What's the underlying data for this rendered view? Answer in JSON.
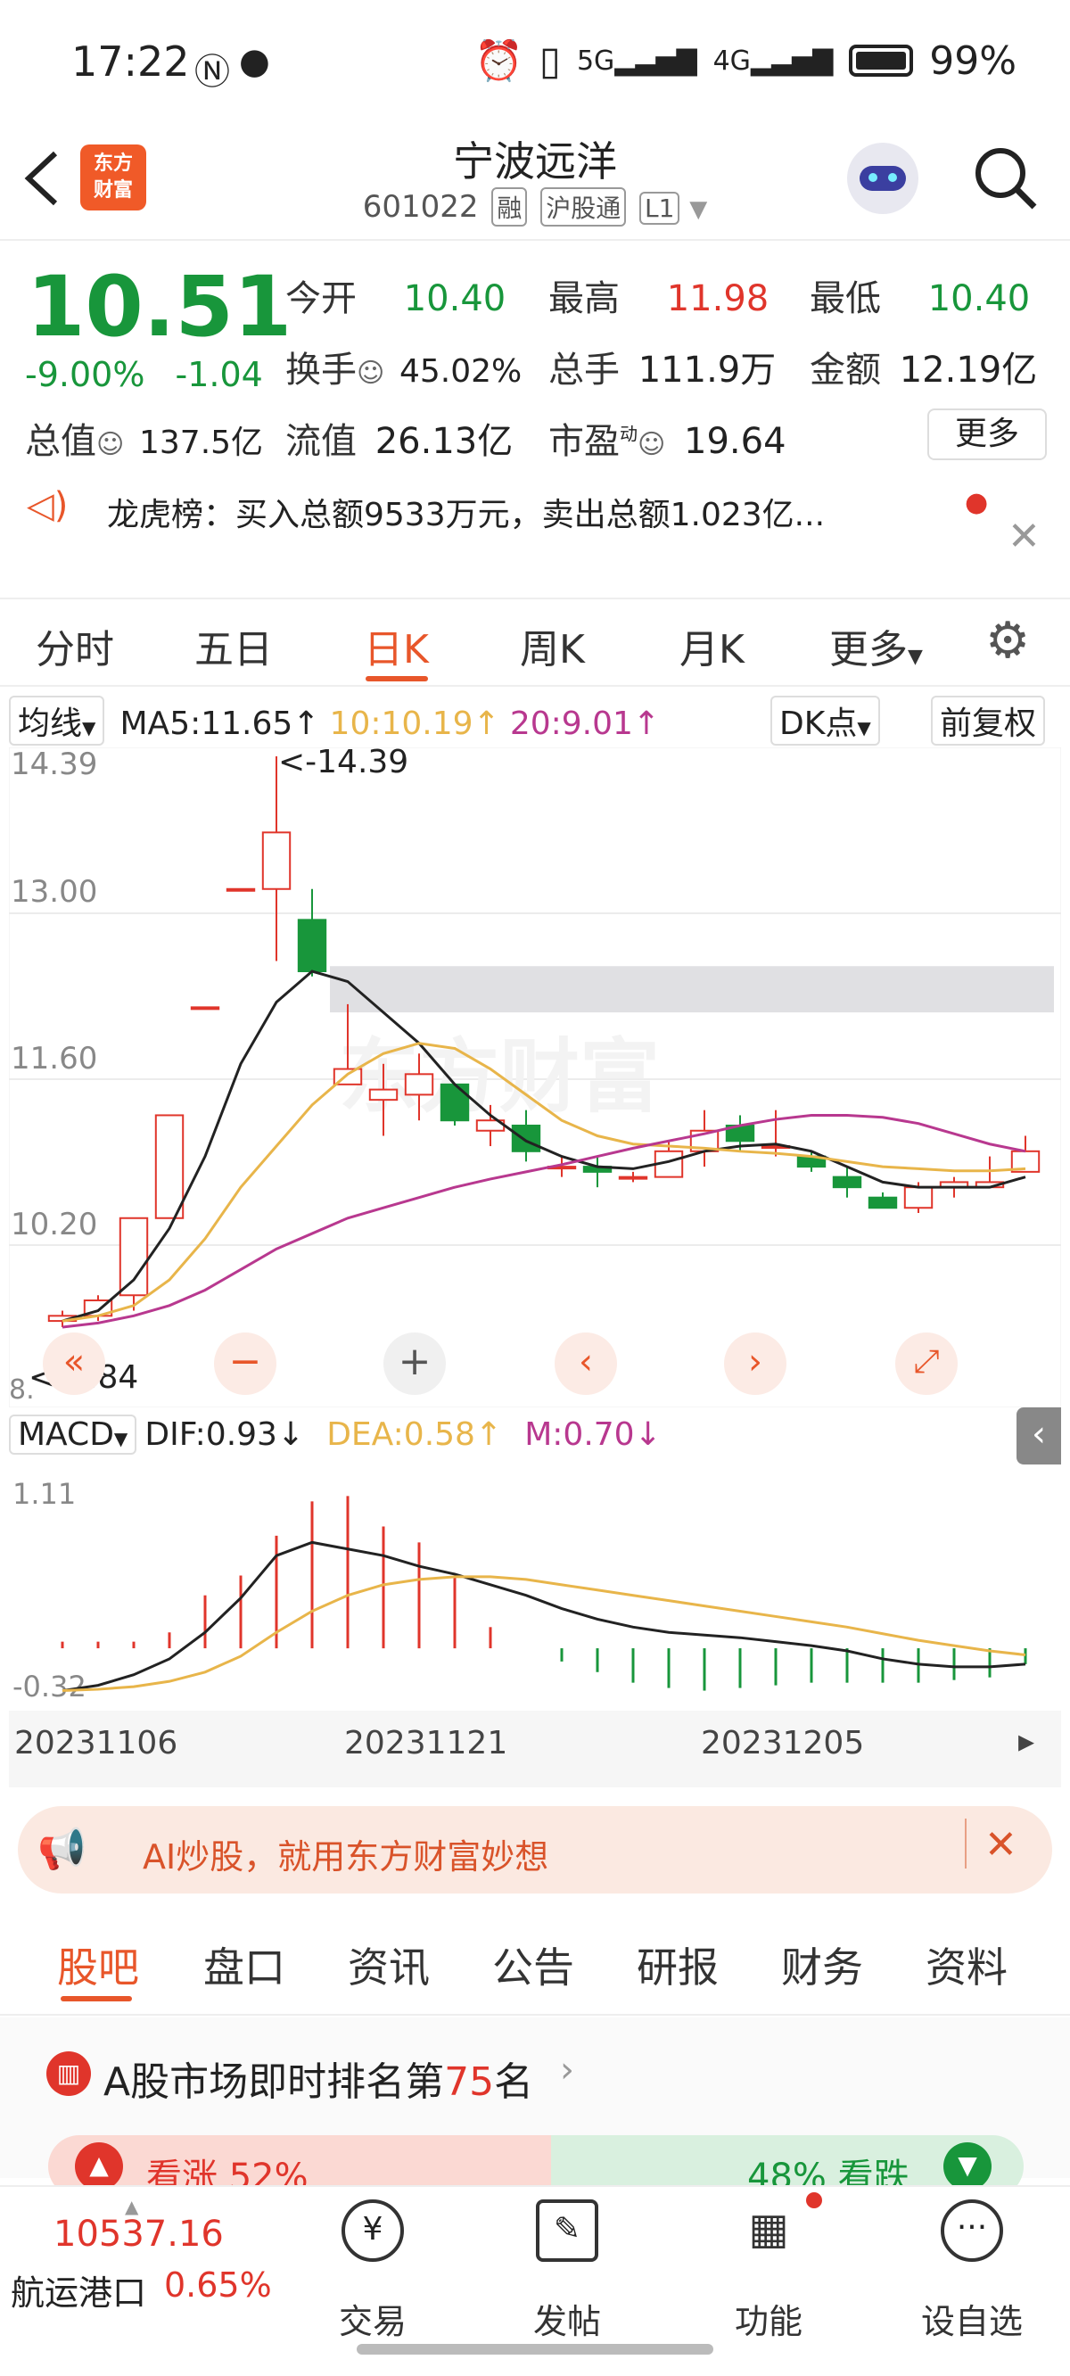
{
  "status_bar": {
    "time": "17:22",
    "network_icons": [
      "nfc-icon",
      "wechat-icon",
      "alarm-icon",
      "vibrate-icon",
      "5g-signal-icon",
      "4g-signal-icon"
    ],
    "battery": "99%"
  },
  "header": {
    "logo_text_line1": "东方",
    "logo_text_line2": "财富",
    "stock_name": "宁波远洋",
    "stock_code": "601022",
    "tag_margin": "融",
    "tag_connect": "沪股通",
    "tag_level": "L1"
  },
  "quote": {
    "price": "10.51",
    "change_pct": "-9.00%",
    "change_amt": "-1.04",
    "open_label": "今开",
    "open": "10.40",
    "high_label": "最高",
    "high": "11.98",
    "low_label": "最低",
    "low": "10.40",
    "turnover_label": "换手",
    "turnover": "45.02%",
    "volume_label": "总手",
    "volume": "111.9万",
    "amount_label": "金额",
    "amount": "12.19亿",
    "mktcap_label": "总值",
    "mktcap": "137.5亿",
    "float_label": "流值",
    "float_cap": "26.13亿",
    "pe_label": "市盈",
    "pe_sup": "动",
    "pe": "19.64",
    "more_label": "更多"
  },
  "notice": {
    "text": "龙虎榜：买入总额9533万元，卖出总额1.023亿..."
  },
  "chart_tabs": {
    "items": [
      "分时",
      "五日",
      "日K",
      "周K",
      "月K",
      "更多"
    ],
    "active_index": 2
  },
  "kline": {
    "indicator_label": "均线",
    "ma5": "MA5:11.65↑",
    "ma10": "10:10.19↑",
    "ma20": "20:9.01↑",
    "dk_label": "DK点",
    "adjust_label": "前复权",
    "y_labels": [
      "14.39",
      "13.00",
      "11.60",
      "10.20"
    ],
    "max_marker": "<-14.39",
    "min_marker": "<-8.84",
    "min_label_partial": "8.",
    "watermark": "东方财富",
    "colors": {
      "up": "#e0352b",
      "down": "#18963b",
      "ma5": "#222222",
      "ma10": "#e8b54a",
      "ma20": "#b8388f"
    }
  },
  "macd": {
    "indicator_label": "MACD",
    "dif": "DIF:0.93↓",
    "dea": "DEA:0.58↑",
    "m": "M:0.70↓",
    "y_top": "1.11",
    "y_bottom": "-0.32",
    "dates": [
      "20231106",
      "20231121",
      "20231205"
    ]
  },
  "chart_data": {
    "type": "candlestick",
    "ylim": [
      8.84,
      14.39
    ],
    "candles": [
      {
        "o": 8.9,
        "c": 8.95,
        "h": 9.0,
        "l": 8.84
      },
      {
        "o": 8.95,
        "c": 9.1,
        "h": 9.15,
        "l": 8.9
      },
      {
        "o": 9.15,
        "c": 9.9,
        "h": 9.9,
        "l": 9.0
      },
      {
        "o": 9.9,
        "c": 10.9,
        "h": 10.9,
        "l": 9.9
      },
      {
        "o": 11.95,
        "c": 11.95,
        "h": 11.95,
        "l": 11.95
      },
      {
        "o": 13.1,
        "c": 13.1,
        "h": 13.1,
        "l": 13.1
      },
      {
        "o": 13.1,
        "c": 13.65,
        "h": 14.39,
        "l": 12.4
      },
      {
        "o": 12.8,
        "c": 12.3,
        "h": 13.1,
        "l": 12.25
      },
      {
        "o": 11.2,
        "c": 11.35,
        "h": 11.98,
        "l": 11.2
      },
      {
        "o": 11.05,
        "c": 11.15,
        "h": 11.4,
        "l": 10.7
      },
      {
        "o": 11.1,
        "c": 11.3,
        "h": 11.5,
        "l": 10.85
      },
      {
        "o": 11.2,
        "c": 10.85,
        "h": 11.2,
        "l": 10.8
      },
      {
        "o": 10.75,
        "c": 10.85,
        "h": 11.0,
        "l": 10.6
      },
      {
        "o": 10.8,
        "c": 10.55,
        "h": 10.95,
        "l": 10.45
      },
      {
        "o": 10.4,
        "c": 10.4,
        "h": 10.5,
        "l": 10.3
      },
      {
        "o": 10.4,
        "c": 10.35,
        "h": 10.5,
        "l": 10.2
      },
      {
        "o": 10.3,
        "c": 10.3,
        "h": 10.35,
        "l": 10.25
      },
      {
        "o": 10.3,
        "c": 10.55,
        "h": 10.65,
        "l": 10.3
      },
      {
        "o": 10.55,
        "c": 10.75,
        "h": 10.95,
        "l": 10.4
      },
      {
        "o": 10.8,
        "c": 10.65,
        "h": 10.9,
        "l": 10.55
      },
      {
        "o": 10.6,
        "c": 10.6,
        "h": 10.95,
        "l": 10.5
      },
      {
        "o": 10.5,
        "c": 10.4,
        "h": 10.55,
        "l": 10.35
      },
      {
        "o": 10.3,
        "c": 10.2,
        "h": 10.4,
        "l": 10.1
      },
      {
        "o": 10.1,
        "c": 10.0,
        "h": 10.15,
        "l": 10.0
      },
      {
        "o": 10.0,
        "c": 10.2,
        "h": 10.25,
        "l": 9.95
      },
      {
        "o": 10.2,
        "c": 10.25,
        "h": 10.3,
        "l": 10.1
      },
      {
        "o": 10.2,
        "c": 10.25,
        "h": 10.5,
        "l": 10.2
      },
      {
        "o": 10.35,
        "c": 10.55,
        "h": 10.7,
        "l": 10.35
      }
    ],
    "ma5": [
      8.9,
      9.0,
      9.3,
      9.8,
      10.5,
      11.4,
      12.0,
      12.3,
      12.2,
      11.9,
      11.6,
      11.2,
      10.9,
      10.65,
      10.5,
      10.4,
      10.38,
      10.45,
      10.55,
      10.6,
      10.62,
      10.55,
      10.4,
      10.25,
      10.2,
      10.2,
      10.2,
      10.3
    ],
    "ma10": [
      8.9,
      8.95,
      9.05,
      9.3,
      9.7,
      10.2,
      10.6,
      11.0,
      11.3,
      11.5,
      11.6,
      11.55,
      11.35,
      11.1,
      10.85,
      10.7,
      10.62,
      10.6,
      10.58,
      10.55,
      10.53,
      10.5,
      10.45,
      10.4,
      10.38,
      10.36,
      10.36,
      10.38
    ],
    "ma20": [
      8.84,
      8.88,
      8.95,
      9.05,
      9.2,
      9.4,
      9.6,
      9.75,
      9.9,
      10.0,
      10.1,
      10.2,
      10.28,
      10.35,
      10.42,
      10.5,
      10.58,
      10.65,
      10.72,
      10.8,
      10.86,
      10.9,
      10.9,
      10.88,
      10.82,
      10.72,
      10.62,
      10.55
    ],
    "resistance_band": [
      11.9,
      12.35
    ],
    "macd_hist": [
      0.05,
      0.05,
      0.05,
      0.12,
      0.4,
      0.55,
      0.85,
      1.11,
      1.15,
      0.92,
      0.8,
      0.55,
      0.16,
      0.0,
      -0.1,
      -0.18,
      -0.26,
      -0.3,
      -0.32,
      -0.3,
      -0.28,
      -0.26,
      -0.26,
      -0.26,
      -0.26,
      -0.24,
      -0.22,
      -0.12
    ],
    "macd_dif": [
      -0.32,
      -0.28,
      -0.2,
      -0.08,
      0.12,
      0.38,
      0.7,
      0.8,
      0.75,
      0.7,
      0.62,
      0.56,
      0.48,
      0.4,
      0.3,
      0.22,
      0.16,
      0.12,
      0.1,
      0.08,
      0.05,
      0.02,
      -0.02,
      -0.08,
      -0.12,
      -0.14,
      -0.14,
      -0.12
    ],
    "macd_dea": [
      -0.32,
      -0.31,
      -0.29,
      -0.25,
      -0.18,
      -0.06,
      0.12,
      0.28,
      0.4,
      0.48,
      0.52,
      0.54,
      0.54,
      0.52,
      0.48,
      0.44,
      0.4,
      0.36,
      0.32,
      0.28,
      0.24,
      0.2,
      0.16,
      0.11,
      0.06,
      0.02,
      -0.02,
      -0.05
    ]
  },
  "ad_banner": {
    "text": "AI炒股，就用东方财富妙想"
  },
  "bottom_tabs": {
    "items": [
      "股吧",
      "盘口",
      "资讯",
      "公告",
      "研报",
      "财务",
      "资料"
    ],
    "active_index": 0
  },
  "rank": {
    "prefix": "A股市场即时排名第",
    "number": "75",
    "suffix": "名",
    "up_label": "看涨 52%",
    "down_label": "48% 看跌"
  },
  "bottom_bar": {
    "index_value": "10537.16",
    "index_name": "航运港口",
    "index_change": "0.65%",
    "items": [
      "交易",
      "发帖",
      "功能",
      "设自选"
    ]
  }
}
